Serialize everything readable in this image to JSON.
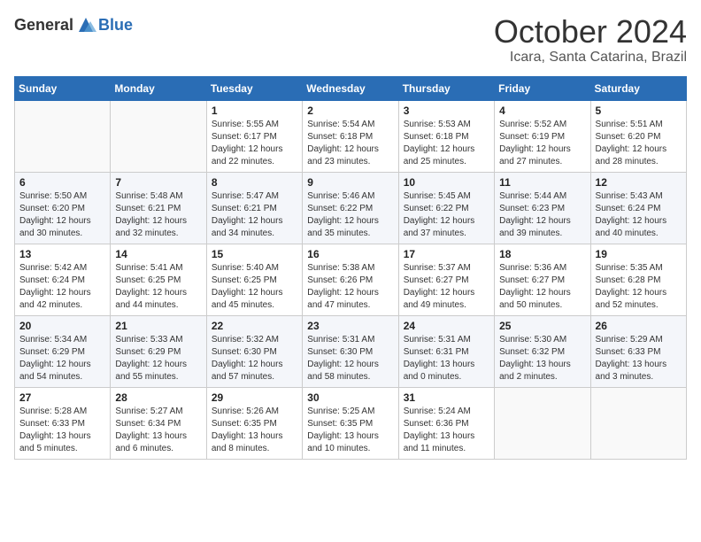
{
  "header": {
    "logo_general": "General",
    "logo_blue": "Blue",
    "month": "October 2024",
    "location": "Icara, Santa Catarina, Brazil"
  },
  "weekdays": [
    "Sunday",
    "Monday",
    "Tuesday",
    "Wednesday",
    "Thursday",
    "Friday",
    "Saturday"
  ],
  "weeks": [
    [
      {
        "day": "",
        "content": ""
      },
      {
        "day": "",
        "content": ""
      },
      {
        "day": "1",
        "content": "Sunrise: 5:55 AM\nSunset: 6:17 PM\nDaylight: 12 hours and 22 minutes."
      },
      {
        "day": "2",
        "content": "Sunrise: 5:54 AM\nSunset: 6:18 PM\nDaylight: 12 hours and 23 minutes."
      },
      {
        "day": "3",
        "content": "Sunrise: 5:53 AM\nSunset: 6:18 PM\nDaylight: 12 hours and 25 minutes."
      },
      {
        "day": "4",
        "content": "Sunrise: 5:52 AM\nSunset: 6:19 PM\nDaylight: 12 hours and 27 minutes."
      },
      {
        "day": "5",
        "content": "Sunrise: 5:51 AM\nSunset: 6:20 PM\nDaylight: 12 hours and 28 minutes."
      }
    ],
    [
      {
        "day": "6",
        "content": "Sunrise: 5:50 AM\nSunset: 6:20 PM\nDaylight: 12 hours and 30 minutes."
      },
      {
        "day": "7",
        "content": "Sunrise: 5:48 AM\nSunset: 6:21 PM\nDaylight: 12 hours and 32 minutes."
      },
      {
        "day": "8",
        "content": "Sunrise: 5:47 AM\nSunset: 6:21 PM\nDaylight: 12 hours and 34 minutes."
      },
      {
        "day": "9",
        "content": "Sunrise: 5:46 AM\nSunset: 6:22 PM\nDaylight: 12 hours and 35 minutes."
      },
      {
        "day": "10",
        "content": "Sunrise: 5:45 AM\nSunset: 6:22 PM\nDaylight: 12 hours and 37 minutes."
      },
      {
        "day": "11",
        "content": "Sunrise: 5:44 AM\nSunset: 6:23 PM\nDaylight: 12 hours and 39 minutes."
      },
      {
        "day": "12",
        "content": "Sunrise: 5:43 AM\nSunset: 6:24 PM\nDaylight: 12 hours and 40 minutes."
      }
    ],
    [
      {
        "day": "13",
        "content": "Sunrise: 5:42 AM\nSunset: 6:24 PM\nDaylight: 12 hours and 42 minutes."
      },
      {
        "day": "14",
        "content": "Sunrise: 5:41 AM\nSunset: 6:25 PM\nDaylight: 12 hours and 44 minutes."
      },
      {
        "day": "15",
        "content": "Sunrise: 5:40 AM\nSunset: 6:25 PM\nDaylight: 12 hours and 45 minutes."
      },
      {
        "day": "16",
        "content": "Sunrise: 5:38 AM\nSunset: 6:26 PM\nDaylight: 12 hours and 47 minutes."
      },
      {
        "day": "17",
        "content": "Sunrise: 5:37 AM\nSunset: 6:27 PM\nDaylight: 12 hours and 49 minutes."
      },
      {
        "day": "18",
        "content": "Sunrise: 5:36 AM\nSunset: 6:27 PM\nDaylight: 12 hours and 50 minutes."
      },
      {
        "day": "19",
        "content": "Sunrise: 5:35 AM\nSunset: 6:28 PM\nDaylight: 12 hours and 52 minutes."
      }
    ],
    [
      {
        "day": "20",
        "content": "Sunrise: 5:34 AM\nSunset: 6:29 PM\nDaylight: 12 hours and 54 minutes."
      },
      {
        "day": "21",
        "content": "Sunrise: 5:33 AM\nSunset: 6:29 PM\nDaylight: 12 hours and 55 minutes."
      },
      {
        "day": "22",
        "content": "Sunrise: 5:32 AM\nSunset: 6:30 PM\nDaylight: 12 hours and 57 minutes."
      },
      {
        "day": "23",
        "content": "Sunrise: 5:31 AM\nSunset: 6:30 PM\nDaylight: 12 hours and 58 minutes."
      },
      {
        "day": "24",
        "content": "Sunrise: 5:31 AM\nSunset: 6:31 PM\nDaylight: 13 hours and 0 minutes."
      },
      {
        "day": "25",
        "content": "Sunrise: 5:30 AM\nSunset: 6:32 PM\nDaylight: 13 hours and 2 minutes."
      },
      {
        "day": "26",
        "content": "Sunrise: 5:29 AM\nSunset: 6:33 PM\nDaylight: 13 hours and 3 minutes."
      }
    ],
    [
      {
        "day": "27",
        "content": "Sunrise: 5:28 AM\nSunset: 6:33 PM\nDaylight: 13 hours and 5 minutes."
      },
      {
        "day": "28",
        "content": "Sunrise: 5:27 AM\nSunset: 6:34 PM\nDaylight: 13 hours and 6 minutes."
      },
      {
        "day": "29",
        "content": "Sunrise: 5:26 AM\nSunset: 6:35 PM\nDaylight: 13 hours and 8 minutes."
      },
      {
        "day": "30",
        "content": "Sunrise: 5:25 AM\nSunset: 6:35 PM\nDaylight: 13 hours and 10 minutes."
      },
      {
        "day": "31",
        "content": "Sunrise: 5:24 AM\nSunset: 6:36 PM\nDaylight: 13 hours and 11 minutes."
      },
      {
        "day": "",
        "content": ""
      },
      {
        "day": "",
        "content": ""
      }
    ]
  ]
}
